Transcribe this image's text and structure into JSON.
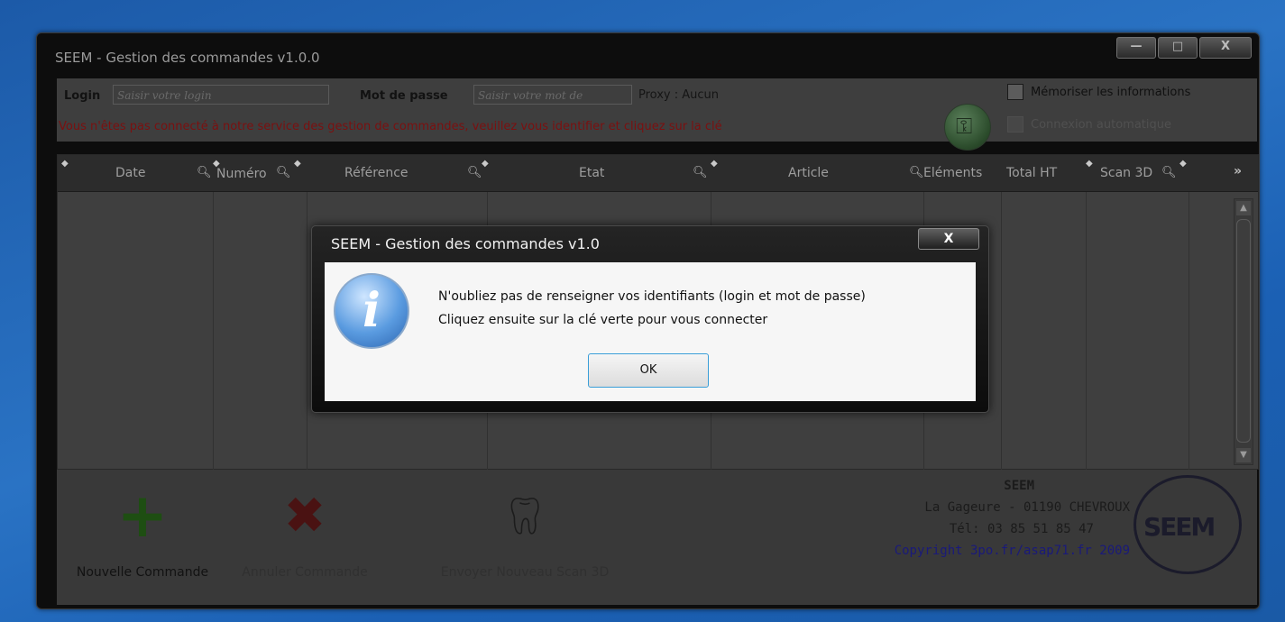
{
  "window": {
    "title": "SEEM - Gestion des commandes v1.0.0",
    "minimize": "—",
    "maximize": "□",
    "close": "X"
  },
  "login": {
    "login_label": "Login",
    "login_placeholder": "Saisir votre login",
    "password_label": "Mot de passe",
    "password_placeholder": "Saisir votre mot de",
    "proxy": "Proxy : Aucun",
    "warning": "Vous n'êtes pas connecté à notre service des gestion de commandes, veuillez vous identifier et cliquez sur la clé",
    "remember": "Mémoriser les informations",
    "auto_connect": "Connexion automatique",
    "key_icon": "key-icon"
  },
  "grid": {
    "columns": [
      "Date",
      "Numéro",
      "Référence",
      "Etat",
      "Article",
      "Eléments",
      "Total HT",
      "Scan 3D"
    ],
    "more_icon": "»"
  },
  "footer": {
    "new_order": "Nouvelle Commande",
    "cancel_order": "Annuler Commande",
    "send_scan": "Envoyer Nouveau Scan 3D",
    "company_name": "SEEM",
    "address": "La Gageure - 01190 CHEVROUX",
    "phone": "Tél: 03 85 51 85 47",
    "copyright": "Copyright 3po.fr/asap71.fr 2009",
    "logo_text": "SEEM"
  },
  "dialog": {
    "title": "SEEM - Gestion des commandes v1.0",
    "close": "X",
    "line1": "N'oubliez pas de renseigner vos identifiants (login et mot de passe)",
    "line2": "Cliquez ensuite sur la clé verte pour vous connecter",
    "ok": "OK",
    "icon": "info-icon"
  },
  "colors": {
    "desktop": "#1f65b6",
    "warning": "#7b1010",
    "dialog_button_border": "#3a9ed8"
  }
}
